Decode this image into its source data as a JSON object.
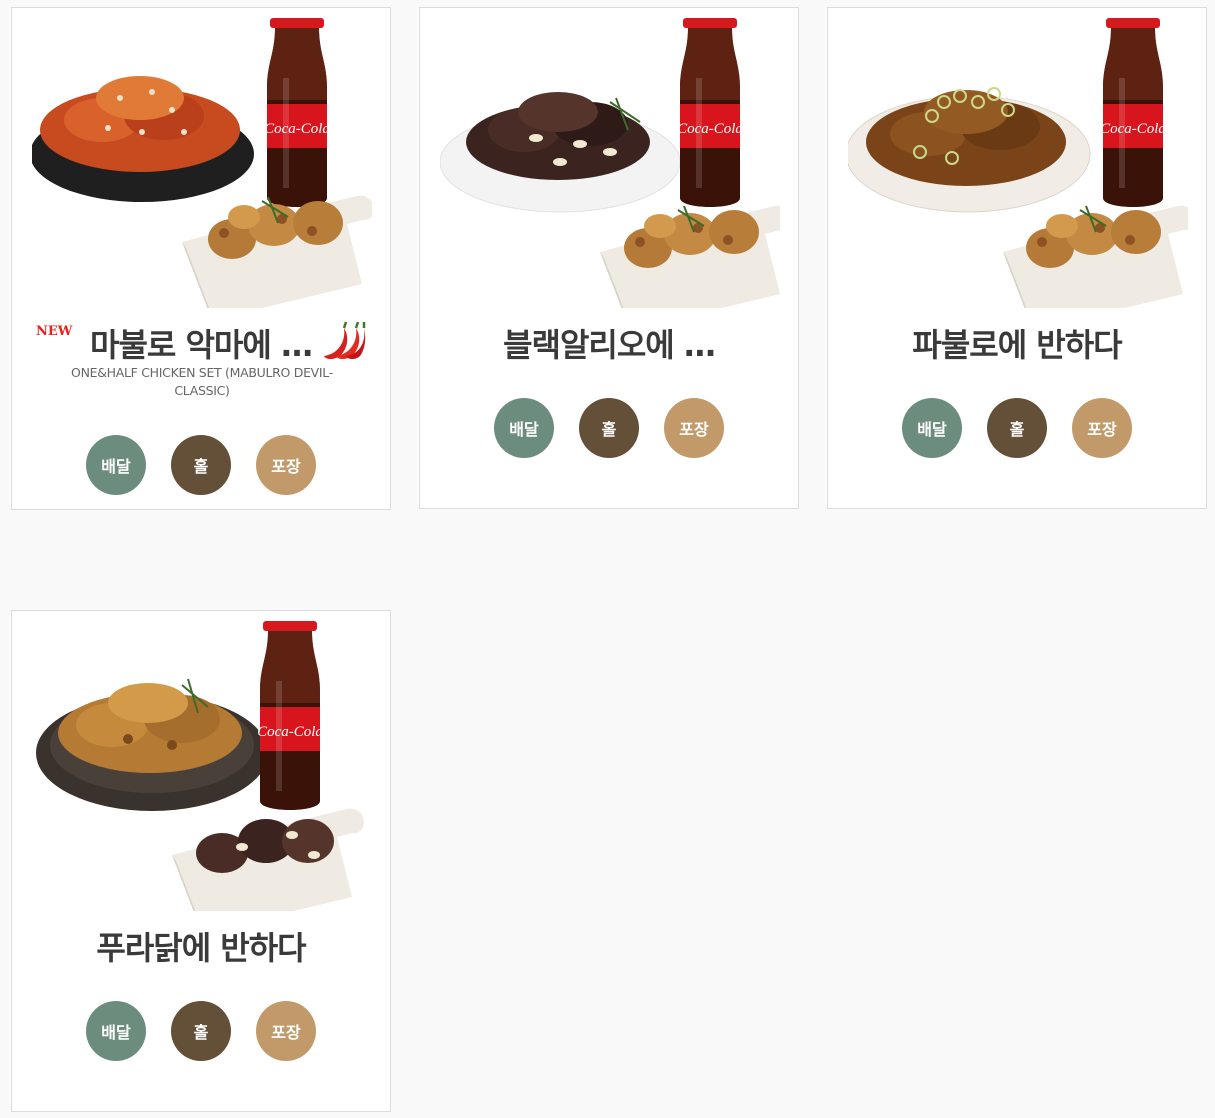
{
  "products": [
    {
      "badge": "NEW",
      "title": "마불로 악마에 …",
      "subtitle": "ONE&HALF CHICKEN SET (MABULRO DEVIL-CLASSIC)",
      "spicy_icon": "chili-pepper-icon",
      "buttons": {
        "delivery": "배달",
        "hall": "홀",
        "takeout": "포장"
      }
    },
    {
      "title": "블랙알리오에 …",
      "buttons": {
        "delivery": "배달",
        "hall": "홀",
        "takeout": "포장"
      }
    },
    {
      "title": "파불로에 반하다",
      "buttons": {
        "delivery": "배달",
        "hall": "홀",
        "takeout": "포장"
      }
    },
    {
      "title": "푸라닭에 반하다",
      "buttons": {
        "delivery": "배달",
        "hall": "홀",
        "takeout": "포장"
      }
    }
  ],
  "colors": {
    "delivery": "#6c8c7d",
    "hall": "#644f39",
    "takeout": "#c29a6a",
    "badge": "#e5231b"
  }
}
